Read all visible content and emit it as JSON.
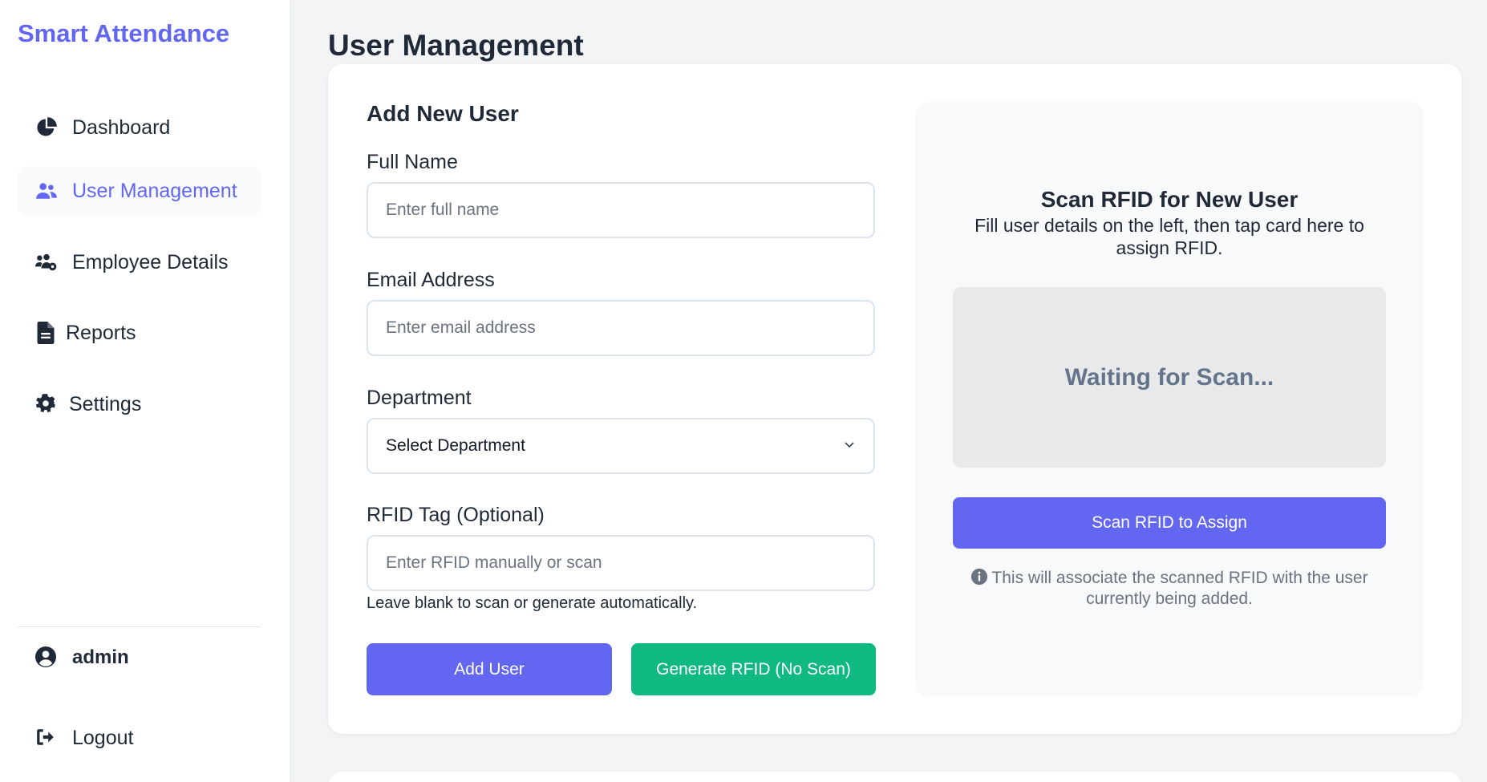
{
  "app": {
    "brand": "Smart Attendance"
  },
  "sidebar": {
    "items": [
      {
        "label": "Dashboard",
        "icon": "chart-pie-icon",
        "active": false
      },
      {
        "label": "User Management",
        "icon": "users-icon",
        "active": true
      },
      {
        "label": "Employee Details",
        "icon": "users-gear-icon",
        "active": false
      },
      {
        "label": "Reports",
        "icon": "file-icon",
        "active": false
      },
      {
        "label": "Settings",
        "icon": "gear-icon",
        "active": false
      }
    ],
    "user": {
      "name": "admin",
      "icon": "user-circle-icon"
    },
    "logout": {
      "label": "Logout",
      "icon": "sign-out-icon"
    }
  },
  "page": {
    "title": "User Management"
  },
  "form": {
    "title": "Add New User",
    "full_name": {
      "label": "Full Name",
      "placeholder": "Enter full name",
      "value": ""
    },
    "email": {
      "label": "Email Address",
      "placeholder": "Enter email address",
      "value": ""
    },
    "department": {
      "label": "Department",
      "selected": "Select Department"
    },
    "rfid": {
      "label": "RFID Tag (Optional)",
      "placeholder": "Enter RFID manually or scan",
      "value": "",
      "hint": "Leave blank to scan or generate automatically."
    },
    "add_button": "Add User",
    "generate_button": "Generate RFID (No Scan)"
  },
  "scan": {
    "title": "Scan RFID for New User",
    "subtitle": "Fill user details on the left, then tap card here to assign RFID.",
    "status": "Waiting for Scan...",
    "button": "Scan RFID to Assign",
    "note": "This will associate the scanned RFID with the user currently being added.",
    "note_icon": "info-circle-icon"
  },
  "colors": {
    "accent": "#6366f1",
    "success": "#10b981",
    "text": "#1f2937",
    "muted": "#64748b"
  }
}
